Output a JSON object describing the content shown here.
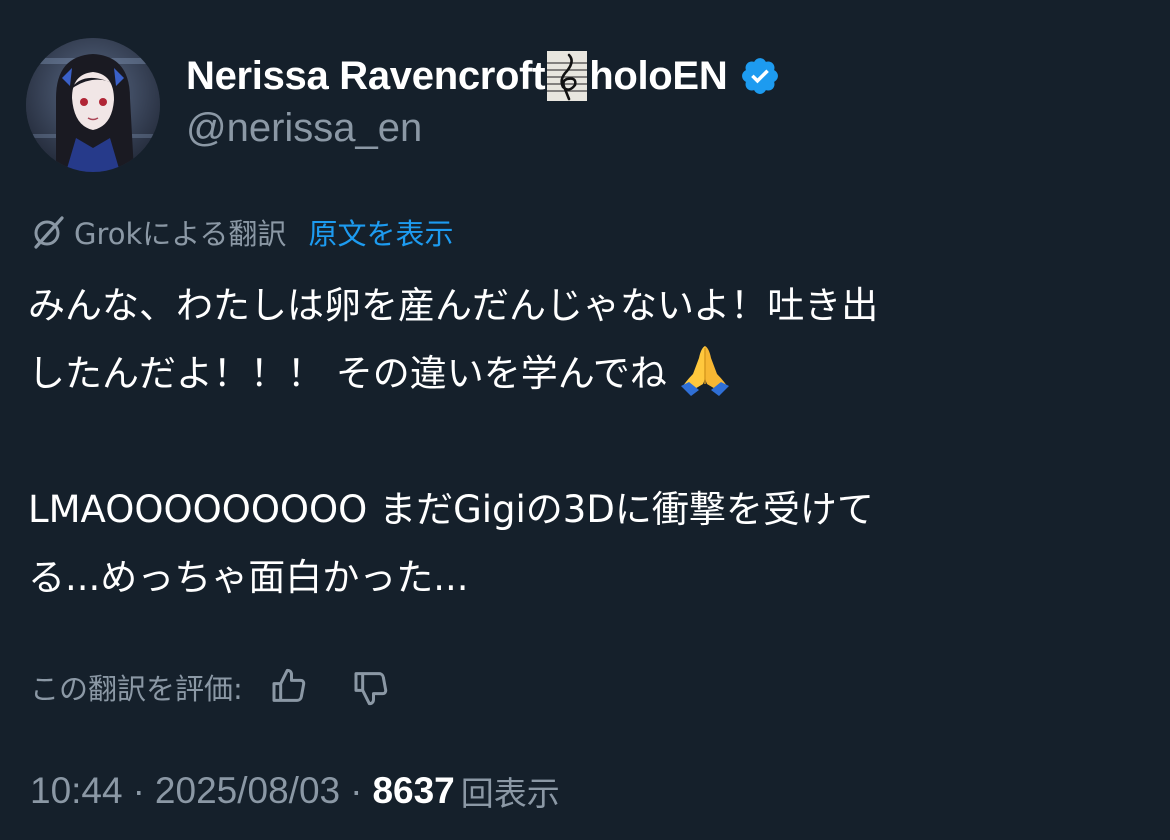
{
  "author": {
    "name_part1": "Nerissa Ravencroft",
    "name_icon": "treble-clef-icon",
    "name_part2": "holoEN",
    "handle": "@nerissa_en",
    "verified": true,
    "verified_color": "#1d9bf0"
  },
  "translation": {
    "icon": "grok-icon",
    "label": "Grokによる翻訳",
    "show_original": "原文を表示"
  },
  "tweet": {
    "lines": [
      "みんな、わたしは卵を産んだんじゃないよ！吐き出",
      "したんだよ！！！ その違いを学んでね",
      "LMAOOOOOOOOO まだGigiの3Dに衝撃を受けて",
      "る...めっちゃ面白かった..."
    ],
    "emoji": "folded-hands-emoji"
  },
  "rating": {
    "label": "この翻訳を評価:",
    "like_icon": "thumbs-up-icon",
    "dislike_icon": "thumbs-down-icon"
  },
  "meta": {
    "time": "10:44",
    "date": "2025/08/03",
    "separator": "·",
    "views_count": "8637",
    "views_label": "回表示"
  },
  "colors": {
    "background": "#15202b",
    "text_primary": "#ffffff",
    "text_secondary": "#8b98a5",
    "accent": "#1d9bf0"
  }
}
